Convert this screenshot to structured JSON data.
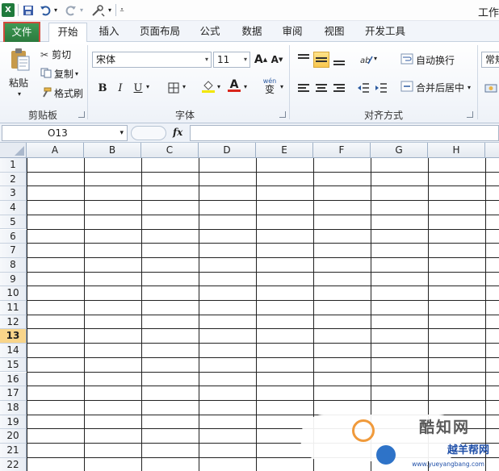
{
  "quick_access": {
    "app_icon_text": "X",
    "undo_icon": "undo-icon",
    "redo_icon": "redo-icon",
    "customize_icon": "customize-qat-icon"
  },
  "title": "工作",
  "tabs": [
    {
      "label": "文件",
      "kind": "file"
    },
    {
      "label": "开始",
      "kind": "active"
    },
    {
      "label": "插入"
    },
    {
      "label": "页面布局"
    },
    {
      "label": "公式"
    },
    {
      "label": "数据"
    },
    {
      "label": "审阅"
    },
    {
      "label": "视图"
    },
    {
      "label": "开发工具"
    }
  ],
  "ribbon": {
    "clipboard": {
      "paste_label": "粘贴",
      "cut_label": "剪切",
      "copy_label": "复制",
      "format_painter_label": "格式刷",
      "group_label": "剪贴板"
    },
    "font": {
      "font_name": "宋体",
      "font_size": "11",
      "bold": "B",
      "italic": "I",
      "underline": "U",
      "grow": "A",
      "shrink": "A",
      "font_color_letter": "A",
      "phonetic": "wén",
      "phonetic_char": "变",
      "group_label": "字体",
      "highlight_color": "#f2e600",
      "font_color": "#d9261c"
    },
    "alignment": {
      "wrap_text_label": "自动换行",
      "merge_center_label": "合并后居中",
      "group_label": "对齐方式"
    },
    "number": {
      "format_label": "常规"
    }
  },
  "formula_bar": {
    "name_box": "O13",
    "fx_label": "fx",
    "formula": ""
  },
  "grid": {
    "columns": [
      "A",
      "B",
      "C",
      "D",
      "E",
      "F",
      "G",
      "H"
    ],
    "rows": [
      "1",
      "2",
      "3",
      "4",
      "5",
      "6",
      "7",
      "8",
      "9",
      "10",
      "11",
      "12",
      "13",
      "14",
      "15",
      "16",
      "17",
      "18",
      "19",
      "20",
      "21",
      "22"
    ],
    "selected_row": "13",
    "selected_row_color": "#f9d58a"
  },
  "watermark": {
    "line1": "酷知网",
    "line2": "越羊帮网",
    "line3": "www.yueyangbang.com"
  }
}
